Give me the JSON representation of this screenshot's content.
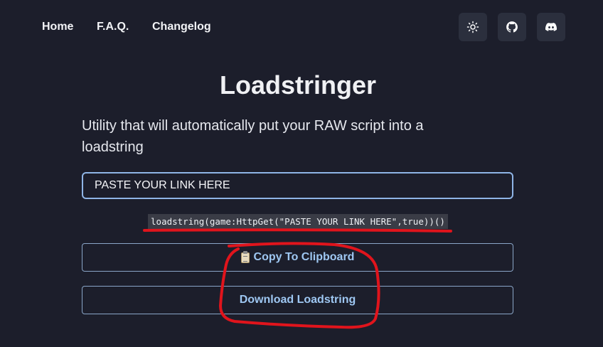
{
  "nav": {
    "links": [
      "Home",
      "F.A.Q.",
      "Changelog"
    ],
    "icons": [
      "sun-icon",
      "github-icon",
      "discord-icon"
    ]
  },
  "main": {
    "title": "Loadstringer",
    "subtitle": "Utility that will automatically put your RAW script into a loadstring",
    "input_value": "PASTE YOUR LINK HERE",
    "code_output": "loadstring(game:HttpGet(\"PASTE YOUR LINK HERE\",true))()",
    "copy_button": "Copy To Clipboard",
    "download_button": "Download Loadstring"
  },
  "colors": {
    "background": "#1c1e2b",
    "accent": "#9ec7f2",
    "annotation": "#e0141c"
  }
}
